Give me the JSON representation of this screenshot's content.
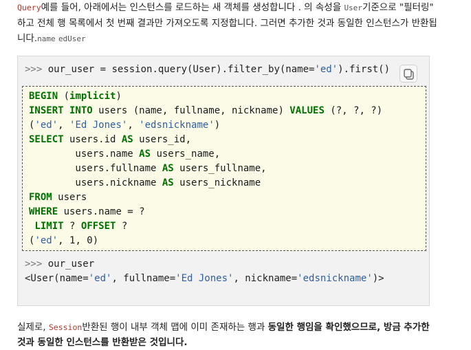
{
  "intro": {
    "code_query": "Query",
    "text1": "예를 들어, 아래에서는 인스턴스를 로드하는 새 객체를 생성합니다 . 의 속성을 ",
    "code_user": "User",
    "text2": "기준으로 \"필터링\" 하고 전체 행 목록에서 첫 번째 결과만 가져오도록 지정합니다. 그러면 추가한 것과 동일한 인스턴스가 반환됩니다.",
    "code_name": "name",
    "code_ed_user": "edUser"
  },
  "code": {
    "line1": ">>> our_user = session.query(User).filter_by(name='ed').first()",
    "copy_icon": "copy-icon",
    "sql": [
      "BEGIN (implicit)",
      "INSERT INTO users (name, fullname, nickname) VALUES (?, ?, ?)",
      "('ed', 'Ed Jones', 'edsnickname')",
      "SELECT users.id AS users_id,",
      "        users.name AS users_name,",
      "        users.fullname AS users_fullname,",
      "        users.nickname AS users_nickname",
      "FROM users",
      "WHERE users.name = ?",
      " LIMIT ? OFFSET ?",
      "('ed', 1, 0)"
    ],
    "out1": ">>> our_user",
    "out2": "<User(name='ed', fullname='Ed Jones', nickname='edsnickname')>"
  },
  "outro": {
    "text1": "실제로, ",
    "code_session": "Session",
    "text2": "반환된 행이 내부 객체 맵에 이미 존재하는 행과 ",
    "bold1": "동일한 행임을 확인했으므로, 방금 추가한 것과 동일한 인스턴스를 반환받은 것입니다."
  }
}
